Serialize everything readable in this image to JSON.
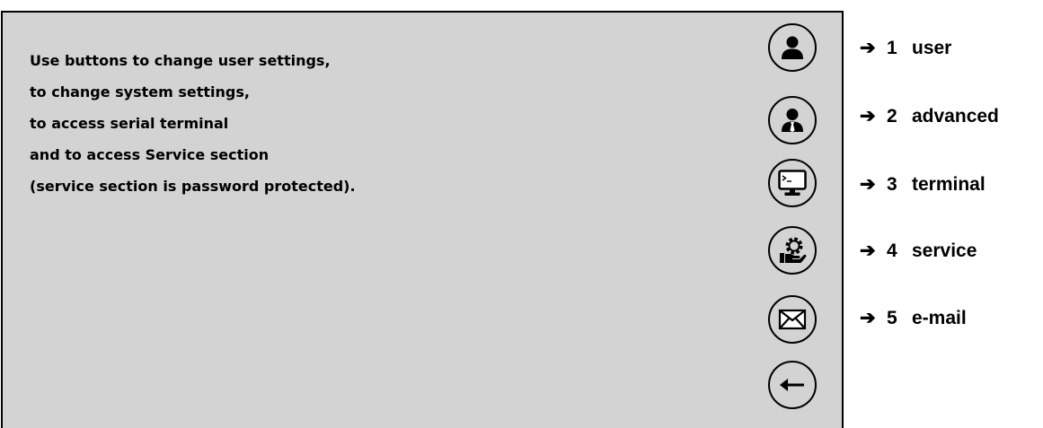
{
  "instructions": {
    "lines": [
      "Use buttons to change user settings,",
      "to change system settings,",
      "to access serial terminal",
      "and to access Service section",
      "(service section is password protected)."
    ]
  },
  "buttons": [
    {
      "icon": "user-icon"
    },
    {
      "icon": "advanced-user-icon"
    },
    {
      "icon": "terminal-icon"
    },
    {
      "icon": "service-icon"
    },
    {
      "icon": "email-icon"
    },
    {
      "icon": "back-arrow-icon"
    }
  ],
  "callouts": [
    {
      "arrow": "➔",
      "number": "1",
      "label": "user"
    },
    {
      "arrow": "➔",
      "number": "2",
      "label": "advanced"
    },
    {
      "arrow": "➔",
      "number": "3",
      "label": "terminal"
    },
    {
      "arrow": "➔",
      "number": "4",
      "label": "service"
    },
    {
      "arrow": "➔",
      "number": "5",
      "label": "e-mail"
    }
  ],
  "colors": {
    "screen_background": "#d3d3d3",
    "border": "#000000",
    "text": "#000000"
  }
}
